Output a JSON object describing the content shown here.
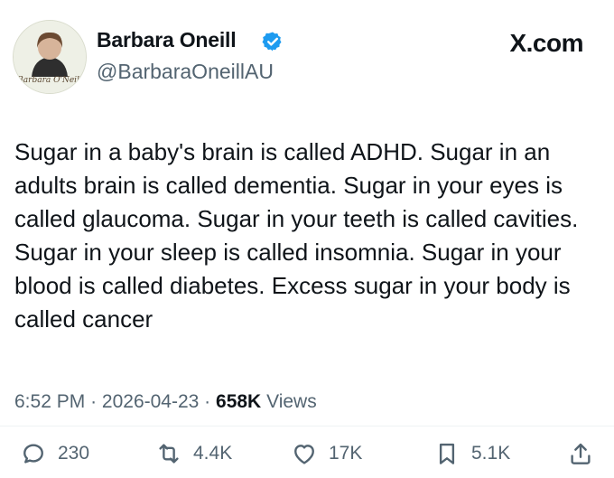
{
  "author": {
    "name": "Barbara Oneill",
    "handle": "@BarbaraOneillAU",
    "avatar_signature": "Barbara O'Neill",
    "verified_icon": "verified-badge-icon"
  },
  "brand": "X.com",
  "tweet": {
    "text": "Sugar in a baby's brain is called ADHD. Sugar in an adults brain is called dementia. Sugar in your eyes is called glaucoma. Sugar in your teeth is called cavities. Sugar in your sleep is called insomnia. Sugar in your blood is called diabetes. Excess sugar in your body is called cancer"
  },
  "meta": {
    "time": "6:52 PM",
    "dot1": "·",
    "date": "2026-04-23",
    "dot2": "·",
    "views_count": "658K",
    "views_label": "Views"
  },
  "actions": {
    "replies": "230",
    "reposts": "4.4K",
    "likes": "17K",
    "bookmarks": "5.1K"
  },
  "colors": {
    "text": "#0f1419",
    "muted": "#536471",
    "verified": "#1d9bf0"
  }
}
